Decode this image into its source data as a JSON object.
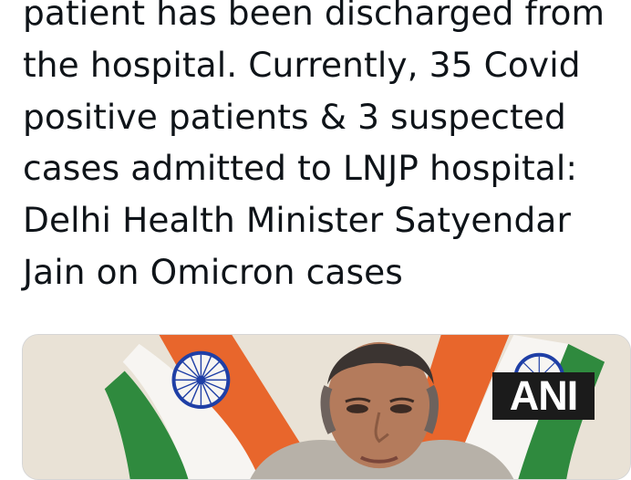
{
  "tweet": {
    "text": "patient has been discharged from\nthe hospital. Currently, 35 Covid\npositive patients & 3 suspected\ncases admitted to LNJP hospital:\nDelhi Health Minister Satyendar\nJain on Omicron cases"
  },
  "media": {
    "watermark": "ANI",
    "colors": {
      "flag_saffron": "#e8662c",
      "flag_white": "#f7f5f2",
      "flag_green": "#2f8a3e",
      "chakra_blue": "#1f3fa6",
      "backdrop": "#e9e1d6"
    }
  }
}
